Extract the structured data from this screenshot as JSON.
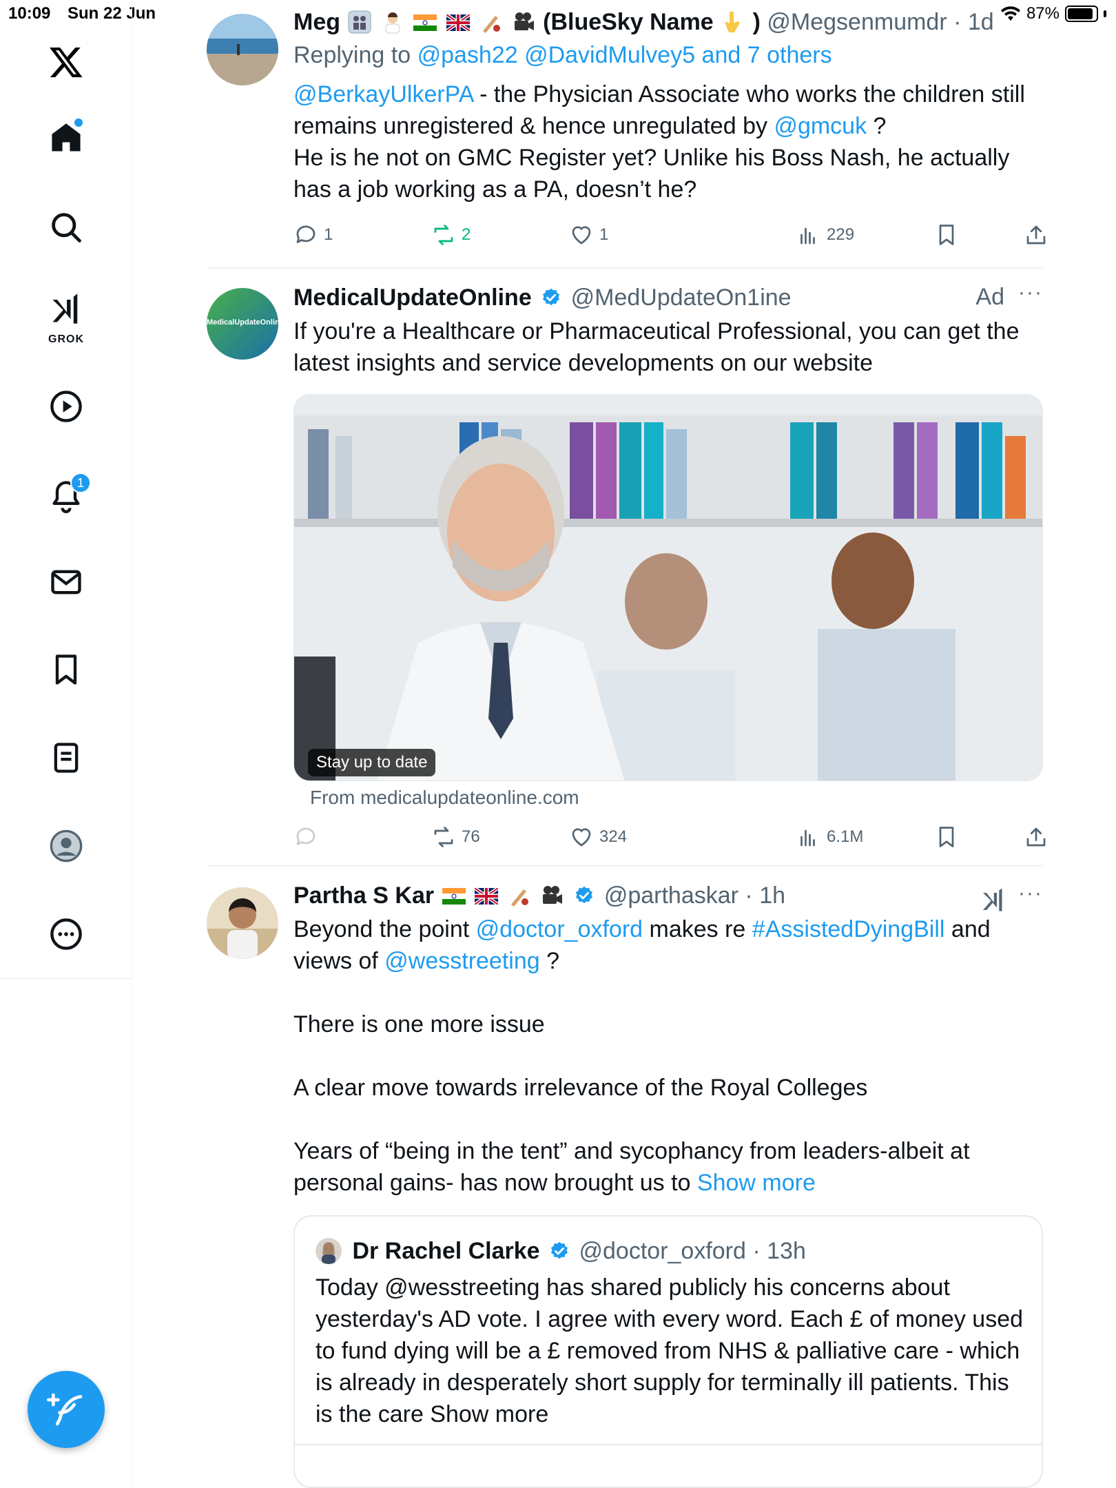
{
  "status_bar": {
    "time": "10:09",
    "date": "Sun 22 Jun",
    "battery": "87%"
  },
  "sidebar": {
    "items": [
      {
        "name": "home",
        "icon": "home-icon"
      },
      {
        "name": "explore",
        "icon": "search-icon"
      },
      {
        "name": "grok",
        "icon": "grok-icon",
        "label": "GROK"
      },
      {
        "name": "video",
        "icon": "play-icon"
      },
      {
        "name": "notifications",
        "icon": "bell-icon",
        "badge": "1"
      },
      {
        "name": "messages",
        "icon": "mail-icon"
      },
      {
        "name": "bookmarks",
        "icon": "bookmark-icon"
      },
      {
        "name": "lists",
        "icon": "list-icon"
      },
      {
        "name": "profile",
        "icon": "profile-icon"
      },
      {
        "name": "more",
        "icon": "more-circle-icon"
      }
    ],
    "compose": "compose-icon"
  },
  "tweets": [
    {
      "name": "Meg",
      "display_suffix": "(BlueSky Name",
      "display_close": ")",
      "handle": "@Megsenmumdr",
      "time": "· 1d",
      "replying_prefix": "Replying to",
      "replying_to": "@pash22 @DavidMulvey5 and 7 others",
      "text": {
        "mention1": "@BerkayUlkerPA",
        "part1": " - the Physician Associate who works the children still remains unregistered & hence unregulated by ",
        "mention2": "@gmcuk",
        "part2": " ?",
        "line2": "He is he not on GMC Register yet? Unlike his Boss Nash, he actually has a job working as a PA, doesn’t he?"
      },
      "stats": {
        "replies": "1",
        "reposts": "2",
        "likes": "1",
        "views": "229"
      }
    },
    {
      "name": "MedicalUpdateOnline",
      "handle": "@MedUpdateOn1ine",
      "ad": "Ad",
      "avatar_text": "MedicalUpdateOnline",
      "text": "If you're a Healthcare or Pharmaceutical Professional, you can get the latest insights and service developments on our website",
      "media_caption": "Stay up to date",
      "from": "From medicalupdateonline.com",
      "stats": {
        "reposts": "76",
        "likes": "324",
        "views": "6.1M"
      }
    },
    {
      "name": "Partha S Kar",
      "handle": "@parthaskar",
      "time": "· 1h",
      "text": {
        "p1a": "Beyond the point ",
        "p1m1": "@doctor_oxford",
        "p1b": " makes re ",
        "p1tag": "#AssistedDyingBill",
        "p1c": " and views of ",
        "p1m2": "@wesstreeting",
        "p1d": " ?",
        "p2": "There is one more issue",
        "p3": "A clear move towards irrelevance of the Royal Colleges",
        "p4": "Years of “being in the tent” and sycophancy from leaders-albeit at personal gains- has now brought us to ",
        "show_more": "Show more"
      },
      "quote": {
        "name": "Dr Rachel Clarke",
        "handle": "@doctor_oxford",
        "time": "· 13h",
        "text": "Today @wesstreeting has shared publicly his concerns about yesterday's AD vote. I agree with every word. Each £ of money used to fund dying will be a £ removed from NHS & palliative care - which is already in desperately short supply for terminally ill patients. This is the care Show more"
      }
    }
  ],
  "colors": {
    "accent": "#1d9bf0",
    "repost_green": "#00ba7c",
    "muted": "#536471",
    "text": "#0f1419"
  }
}
